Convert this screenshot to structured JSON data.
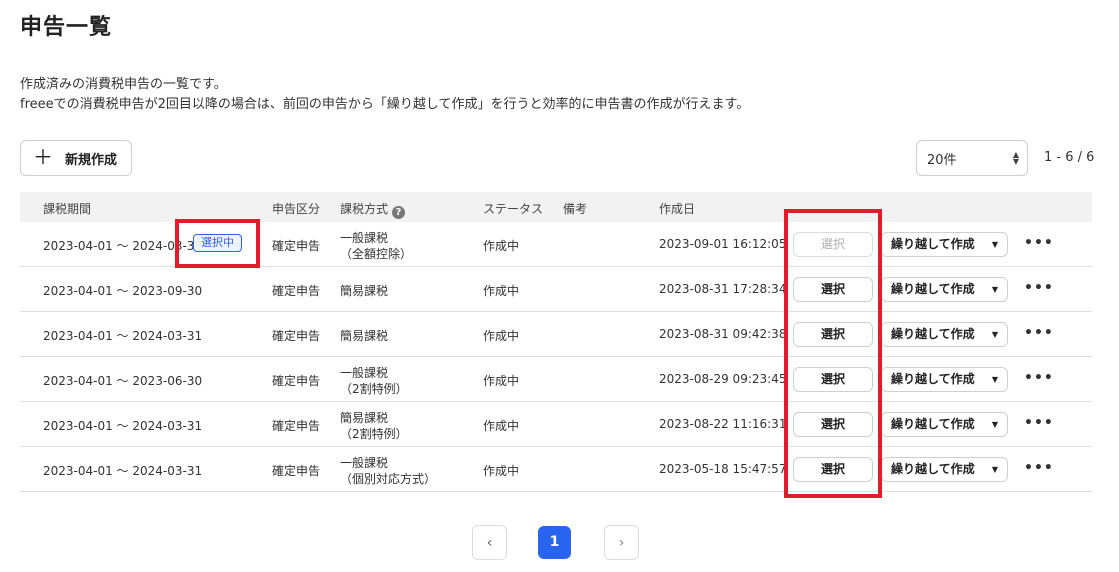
{
  "page": {
    "title": "申告一覧",
    "description_line1": "作成済みの消費税申告の一覧です。",
    "description_line2": "freeeでの消費税申告が2回目以降の場合は、前回の申告から「繰り越して作成」を行うと効率的に申告書の作成が行えます。"
  },
  "toolbar": {
    "new_label": "新規作成",
    "perpage_value": "20件",
    "range_text": "1 - 6 / 6"
  },
  "table": {
    "headers": {
      "period": "課税期間",
      "kind": "申告区分",
      "method": "課税方式",
      "status": "ステータス",
      "note": "備考",
      "created": "作成日"
    },
    "selected_badge": "選択中",
    "select_label": "選択",
    "carry_label": "繰り越して作成",
    "rows": [
      {
        "period": "2023-04-01 ～ 2024-03-31",
        "kind": "確定申告",
        "method": "一般課税",
        "method_sub": "（全額控除）",
        "status": "作成中",
        "created": "2023-09-01 16:12:05"
      },
      {
        "period": "2023-04-01 ～ 2023-09-30",
        "kind": "確定申告",
        "method": "簡易課税",
        "method_sub": "",
        "status": "作成中",
        "created": "2023-08-31 17:28:34"
      },
      {
        "period": "2023-04-01 ～ 2024-03-31",
        "kind": "確定申告",
        "method": "簡易課税",
        "method_sub": "",
        "status": "作成中",
        "created": "2023-08-31 09:42:38"
      },
      {
        "period": "2023-04-01 ～ 2023-06-30",
        "kind": "確定申告",
        "method": "一般課税",
        "method_sub": "（2割特例）",
        "status": "作成中",
        "created": "2023-08-29 09:23:45"
      },
      {
        "period": "2023-04-01 ～ 2024-03-31",
        "kind": "確定申告",
        "method": "簡易課税",
        "method_sub": "（2割特例）",
        "status": "作成中",
        "created": "2023-08-22 11:16:31"
      },
      {
        "period": "2023-04-01 ～ 2024-03-31",
        "kind": "確定申告",
        "method": "一般課税",
        "method_sub": "（個別対応方式）",
        "status": "作成中",
        "created": "2023-05-18 15:47:57"
      }
    ]
  },
  "pagination": {
    "current": "1",
    "prev_glyph": "‹",
    "next_glyph": "›"
  },
  "icons": {
    "plus": "plus-icon",
    "help": "help-icon",
    "caret": "caret-down-icon",
    "more": "more-icon"
  },
  "colors": {
    "accent": "#2864f0",
    "highlight": "#e01e2b"
  }
}
